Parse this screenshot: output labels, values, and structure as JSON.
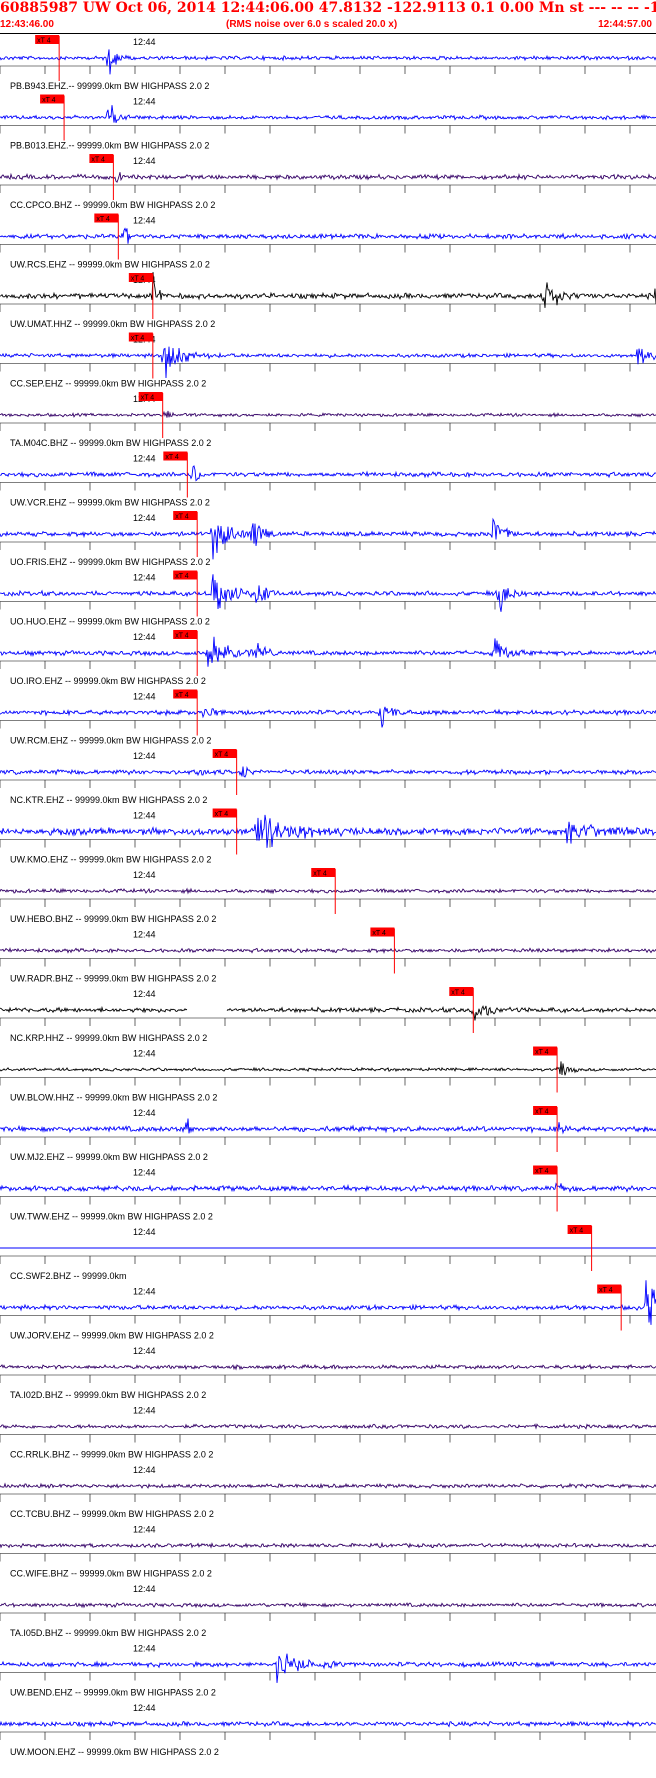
{
  "header": {
    "title": "60885987 UW Oct 06, 2014 12:44:06.00   47.8132 -122.9113  0.1 0.00 Mn st --- -- --   -1",
    "start_time": "12:43:46.00",
    "scale_note": "(RMS noise over 6.0 s scaled 20.0 x)",
    "end_time": "12:44:57.00"
  },
  "chart_data": {
    "type": "line",
    "title": "60885987 UW Oct 06, 2014 12:44:06.00   47.8132 -122.9113  0.1 0.00 Mn st --- -- --   -1",
    "x_start": "12:43:46.00",
    "x_end": "12:44:57.00",
    "minute_tick_label": "12:44",
    "pick_label": "xT 4",
    "grid": false,
    "colors": {
      "header": "#ff0000",
      "pick": "#ff0000",
      "blue": "#0000ff",
      "purple": "#330066",
      "black": "#000000"
    },
    "series": [
      {
        "name": "PB.B943.EHZ.--.99999.0km.BW..HIGHPASS..2.0..2",
        "label": "PB.B943.EHZ.-- 99999.0km BW  HIGHPASS  2.0  2",
        "color": "blue",
        "pick": 12,
        "amp": 0.25,
        "events": [
          [
            22,
            0.8,
            0.8
          ]
        ]
      },
      {
        "name": "PB.B013.EHZ.--.99999.0km.BW..HIGHPASS..2.0..2",
        "label": "PB.B013.EHZ.-- 99999.0km BW  HIGHPASS  2.0  2",
        "color": "blue",
        "pick": 13,
        "amp": 0.25,
        "events": [
          [
            22,
            0.8,
            0.8
          ]
        ]
      },
      {
        "name": "CC.CPCO.BHZ.--.99999.0km.BW..HIGHPASS..2.0..2",
        "label": "CC.CPCO.BHZ -- 99999.0km BW  HIGHPASS  2.0  2",
        "color": "purple",
        "pick": 23,
        "amp": 0.3,
        "events": [
          [
            23.5,
            1.0,
            0.3
          ]
        ]
      },
      {
        "name": "UW.RCS.EHZ.--.99999.0km.BW..HIGHPASS..2.0..2",
        "label": "UW.RCS.EHZ -- 99999.0km BW  HIGHPASS  2.0  2",
        "color": "blue",
        "pick": 24,
        "amp": 0.3,
        "events": [
          [
            25,
            0.7,
            0.5
          ],
          [
            133.5,
            0.7,
            0.2
          ]
        ]
      },
      {
        "name": "UW.UMAT.HHZ.--.99999.0km.BW..HIGHPASS..2.0..2",
        "label": "UW.UMAT.HHZ -- 99999.0km BW  HIGHPASS  2.0  2",
        "color": "black",
        "pick": 31,
        "amp": 0.35,
        "events": [
          [
            31,
            1.0,
            0.6
          ],
          [
            110,
            1.0,
            1.5
          ],
          [
            133,
            1.0,
            1.0
          ]
        ]
      },
      {
        "name": "CC.SEP.EHZ.--.99999.0km.BW..HIGHPASS..2.0..2",
        "label": "CC.SEP.EHZ -- 99999.0km BW  HIGHPASS  2.0  2",
        "color": "blue",
        "pick": 31,
        "amp": 0.25,
        "events": [
          [
            33,
            1.0,
            2.0
          ],
          [
            129,
            0.7,
            1.2
          ]
        ]
      },
      {
        "name": "TA.M04C.BHZ.--.99999.0km.BW..HIGHPASS..2.0..2",
        "label": "TA.M04C.BHZ -- 99999.0km BW  HIGHPASS  2.0  2",
        "color": "purple",
        "pick": 33,
        "amp": 0.2,
        "events": [
          [
            33.5,
            0.5,
            0.4
          ]
        ]
      },
      {
        "name": "UW.VCR.EHZ.--.99999.0km.BW..HIGHPASS..2.0..2",
        "label": "UW.VCR.EHZ -- 99999.0km BW  HIGHPASS  2.0  2",
        "color": "blue",
        "pick": 38,
        "amp": 0.3,
        "events": [
          [
            39,
            0.8,
            0.6
          ]
        ]
      },
      {
        "name": "UO.FRIS.EHZ.--.99999.0km.BW..HIGHPASS..2.0..2",
        "label": "UO.FRIS.EHZ -- 99999.0km BW  HIGHPASS  2.0  2",
        "color": "blue",
        "pick": 40,
        "amp": 0.3,
        "events": [
          [
            43,
            1.0,
            2.0
          ],
          [
            51,
            1.0,
            1.0
          ],
          [
            100,
            1.0,
            1.0
          ]
        ]
      },
      {
        "name": "UO.HUO.EHZ.--.99999.0km.BW..HIGHPASS..2.0..2",
        "label": "UO.HUO.EHZ -- 99999.0km BW  HIGHPASS  2.0  2",
        "color": "blue",
        "pick": 40,
        "amp": 0.3,
        "events": [
          [
            43,
            1.0,
            2.0
          ],
          [
            52,
            1.0,
            1.0
          ],
          [
            101,
            1.0,
            1.0
          ]
        ]
      },
      {
        "name": "UO.IRO.EHZ.--.99999.0km.BW..HIGHPASS..2.0..2",
        "label": "UO.IRO.EHZ -- 99999.0km BW  HIGHPASS  2.0  2",
        "color": "blue",
        "pick": 40,
        "amp": 0.3,
        "events": [
          [
            42,
            1.0,
            2.0
          ],
          [
            52,
            1.0,
            1.0
          ],
          [
            100,
            1.0,
            1.0
          ]
        ]
      },
      {
        "name": "UW.RCM.EHZ.--.99999.0km.BW..HIGHPASS..2.0..2",
        "label": "UW.RCM.EHZ -- 99999.0km BW  HIGHPASS  2.0  2",
        "color": "blue",
        "pick": 40,
        "amp": 0.3,
        "events": [
          [
            41,
            0.6,
            0.8
          ],
          [
            77,
            0.7,
            1.0
          ]
        ]
      },
      {
        "name": "NC.KTR.EHZ.--.99999.0km.BW..HIGHPASS..2.0..2",
        "label": "NC.KTR.EHZ -- 99999.0km BW  HIGHPASS  2.0  2",
        "color": "blue",
        "pick": 48,
        "amp": 0.3,
        "events": [
          [
            49,
            0.8,
            0.5
          ],
          [
            40,
            0.5,
            0.5
          ]
        ]
      },
      {
        "name": "UW.KMO.EHZ.--.99999.0km.BW..HIGHPASS..2.0..2",
        "label": "UW.KMO.EHZ -- 99999.0km BW  HIGHPASS  2.0  2",
        "color": "blue",
        "pick": 48,
        "amp": 0.45,
        "events": [
          [
            52,
            0.8,
            4.0
          ],
          [
            115,
            0.5,
            3.0
          ]
        ]
      },
      {
        "name": "UW.HEBO.BHZ.--.99999.0km.BW..HIGHPASS..2.0..2",
        "label": "UW.HEBO.BHZ -- 99999.0km BW  HIGHPASS  2.0  2",
        "color": "purple",
        "pick": 68,
        "amp": 0.25,
        "events": []
      },
      {
        "name": "UW.RADR.BHZ.--.99999.0km.BW..HIGHPASS..2.0..2",
        "label": "UW.RADR.BHZ -- 99999.0km BW  HIGHPASS  2.0  2",
        "color": "purple",
        "pick": 80,
        "amp": 0.25,
        "events": []
      },
      {
        "name": "NC.KRP.HHZ.--.99999.0km.BW..HIGHPASS..2.0..2",
        "label": "NC.KRP.HHZ -- 99999.0km BW  HIGHPASS  2.0  2",
        "color": "black",
        "pick": 96,
        "amp": 0.3,
        "events": [
          [
            96,
            0.6,
            1.5
          ]
        ],
        "gap": [
          38,
          46
        ]
      },
      {
        "name": "UW.BLOW.HHZ.--.99999.0km.BW..HIGHPASS..2.0..2",
        "label": "UW.BLOW.HHZ -- 99999.0km BW  HIGHPASS  2.0  2",
        "color": "black",
        "pick": 113,
        "amp": 0.2,
        "events": [
          [
            113,
            0.8,
            0.8
          ]
        ]
      },
      {
        "name": "UW.MJ2.EHZ.--.99999.0km.BW..HIGHPASS..2.0..2",
        "label": "UW.MJ2.EHZ -- 99999.0km BW  HIGHPASS  2.0  2",
        "color": "blue",
        "pick": 113,
        "amp": 0.35,
        "events": [
          [
            38,
            0.9,
            0.1
          ],
          [
            113,
            0.5,
            0.5
          ]
        ]
      },
      {
        "name": "UW.TWW.EHZ.--.99999.0km.BW..HIGHPASS..2.0..2",
        "label": "UW.TWW.EHZ -- 99999.0km BW  HIGHPASS  2.0  2",
        "color": "blue",
        "pick": 113,
        "amp": 0.35,
        "events": [
          [
            113,
            0.4,
            0.5
          ]
        ]
      },
      {
        "name": "CC.SWF2.BHZ.--.99999.0km",
        "label": "CC.SWF2.BHZ -- 99999.0km",
        "color": "blue",
        "pick": 120,
        "amp": 0,
        "events": [],
        "flat": true
      },
      {
        "name": "UW.JORV.EHZ.--.99999.0km.BW..HIGHPASS..2.0..2",
        "label": "UW.JORV.EHZ -- 99999.0km BW  HIGHPASS  2.0  2",
        "color": "blue",
        "pick": 126,
        "amp": 0.3,
        "events": [
          [
            131,
            1.0,
            4.0
          ]
        ]
      },
      {
        "name": "TA.I02D.BHZ.--.99999.0km.BW..HIGHPASS..2.0..2",
        "label": "TA.I02D.BHZ -- 99999.0km BW  HIGHPASS  2.0  2",
        "color": "purple",
        "pick": 140,
        "amp": 0.25,
        "events": []
      },
      {
        "name": "CC.RRLK.BHZ.--.99999.0km.BW..HIGHPASS..2.0..2",
        "label": "CC.RRLK.BHZ -- 99999.0km BW  HIGHPASS  2.0  2",
        "color": "purple",
        "pick": null,
        "amp": 0.25,
        "events": []
      },
      {
        "name": "CC.TCBU.BHZ.--.99999.0km.BW..HIGHPASS..2.0..2",
        "label": "CC.TCBU.BHZ -- 99999.0km BW  HIGHPASS  2.0  2",
        "color": "purple",
        "pick": null,
        "amp": 0.25,
        "events": []
      },
      {
        "name": "CC.WIFE.BHZ.--.99999.0km.BW..HIGHPASS..2.0..2",
        "label": "CC.WIFE.BHZ -- 99999.0km BW  HIGHPASS  2.0  2",
        "color": "purple",
        "pick": null,
        "amp": 0.25,
        "events": []
      },
      {
        "name": "TA.I05D.BHZ.--.99999.0km.BW..HIGHPASS..2.0..2",
        "label": "TA.I05D.BHZ -- 99999.0km BW  HIGHPASS  2.0  2",
        "color": "purple",
        "pick": null,
        "amp": 0.25,
        "events": []
      },
      {
        "name": "UW.BEND.EHZ.--.99999.0km.BW..HIGHPASS..2.0..2",
        "label": "UW.BEND.EHZ -- 99999.0km BW  HIGHPASS  2.0  2",
        "color": "blue",
        "pick": null,
        "amp": 0.3,
        "events": [
          [
            56,
            0.6,
            3.0
          ]
        ]
      },
      {
        "name": "UW.MOON.EHZ.--.99999.0km.BW..HIGHPASS..2.0..2",
        "label": "UW.MOON.EHZ -- 99999.0km BW  HIGHPASS  2.0  2",
        "color": "blue",
        "pick": null,
        "amp": 0.3,
        "events": []
      }
    ]
  }
}
